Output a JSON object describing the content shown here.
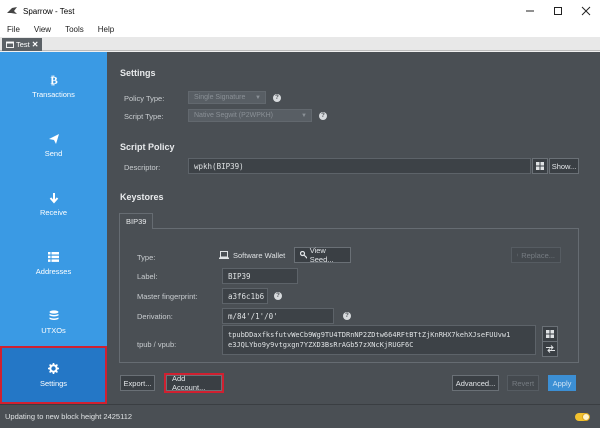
{
  "window": {
    "title": "Sparrow - Test"
  },
  "menu": [
    "File",
    "View",
    "Tools",
    "Help"
  ],
  "tab": {
    "label": "Test"
  },
  "sidebar": {
    "items": [
      {
        "label": "Transactions",
        "icon": "bitcoin-icon"
      },
      {
        "label": "Send",
        "icon": "send-icon"
      },
      {
        "label": "Receive",
        "icon": "receive-icon"
      },
      {
        "label": "Addresses",
        "icon": "list-icon"
      },
      {
        "label": "UTXOs",
        "icon": "coins-icon"
      },
      {
        "label": "Settings",
        "icon": "gear-icon",
        "active": true
      }
    ]
  },
  "settings": {
    "heading": "Settings",
    "policy_type_label": "Policy Type:",
    "policy_type_value": "Single Signature",
    "script_type_label": "Script Type:",
    "script_type_value": "Native Segwit (P2WPKH)"
  },
  "script_policy": {
    "heading": "Script Policy",
    "descriptor_label": "Descriptor:",
    "descriptor_value": "wpkh(BIP39)",
    "show_button": "Show..."
  },
  "keystores": {
    "heading": "Keystores",
    "tab_label": "BIP39",
    "type_label": "Type:",
    "type_value": "Software Wallet",
    "view_seed_button": "View Seed...",
    "replace_button": "Replace...",
    "label_label": "Label:",
    "label_value": "BIP39",
    "fingerprint_label": "Master fingerprint:",
    "fingerprint_value": "a3f6c1b6",
    "derivation_label": "Derivation:",
    "derivation_value": "m/84'/1'/0'",
    "xpub_label": "tpub / vpub:",
    "xpub_line1": "tpubDDaxfksfutvWeCb9Wg9TU4TDRnNP2ZDtw664RFtBTtZjKnRHX7kehXJseFUUvw1",
    "xpub_line2": "e3JQLYbo9y9vtgxgn7YZXD3BsRrAGb57zXNcKjRUGF6C"
  },
  "footer": {
    "export_button": "Export...",
    "add_account_button": "Add Account...",
    "advanced_button": "Advanced...",
    "revert_button": "Revert",
    "apply_button": "Apply"
  },
  "status": {
    "text": "Updating to new block height 2425112"
  },
  "colors": {
    "sidebar": "#3a9ae4",
    "main": "#4a4f54",
    "highlight": "#d02030",
    "accent": "#3c8fd4"
  }
}
